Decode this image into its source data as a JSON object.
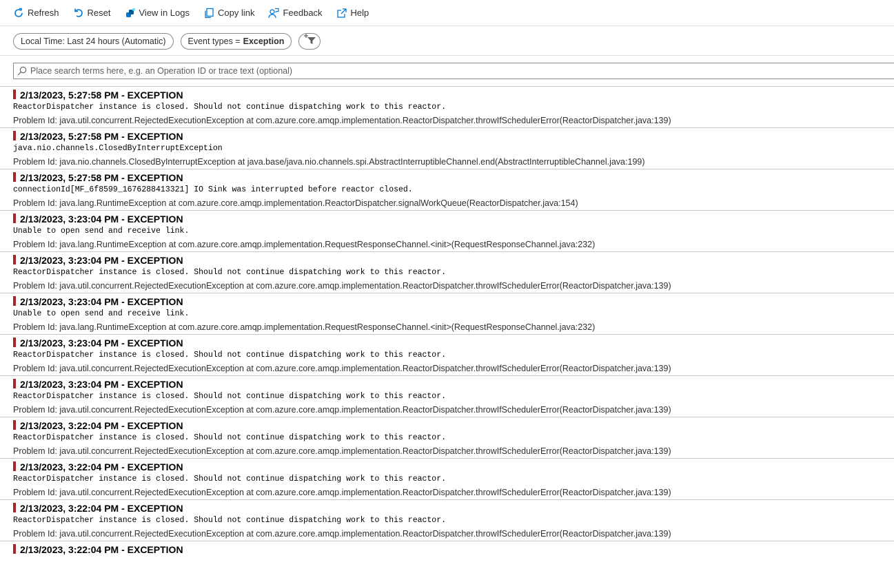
{
  "toolbar": {
    "refresh": "Refresh",
    "reset": "Reset",
    "view_in_logs": "View in Logs",
    "copy_link": "Copy link",
    "feedback": "Feedback",
    "help": "Help"
  },
  "filters": {
    "time": "Local Time: Last 24 hours (Automatic)",
    "event_types_label": "Event types =",
    "event_types_value": "Exception"
  },
  "search": {
    "placeholder": "Place search terms here, e.g. an Operation ID or trace text (optional)",
    "value": ""
  },
  "colors": {
    "accent": "#0078d4",
    "exception_marker": "#a4262c"
  },
  "entries": [
    {
      "title": "2/13/2023, 5:27:58 PM - EXCEPTION",
      "message": "ReactorDispatcher instance is closed. Should not continue dispatching work to this reactor.",
      "problem": "Problem Id: java.util.concurrent.RejectedExecutionException at com.azure.core.amqp.implementation.ReactorDispatcher.throwIfSchedulerError(ReactorDispatcher.java:139)"
    },
    {
      "title": "2/13/2023, 5:27:58 PM - EXCEPTION",
      "message": "java.nio.channels.ClosedByInterruptException",
      "problem": "Problem Id: java.nio.channels.ClosedByInterruptException at java.base/java.nio.channels.spi.AbstractInterruptibleChannel.end(AbstractInterruptibleChannel.java:199)"
    },
    {
      "title": "2/13/2023, 5:27:58 PM - EXCEPTION",
      "message": "connectionId[MF_6f8599_1676288413321] IO Sink was interrupted before reactor closed.",
      "problem": "Problem Id: java.lang.RuntimeException at com.azure.core.amqp.implementation.ReactorDispatcher.signalWorkQueue(ReactorDispatcher.java:154)"
    },
    {
      "title": "2/13/2023, 3:23:04 PM - EXCEPTION",
      "message": "Unable to open send and receive link.",
      "problem": "Problem Id: java.lang.RuntimeException at com.azure.core.amqp.implementation.RequestResponseChannel.<init>(RequestResponseChannel.java:232)"
    },
    {
      "title": "2/13/2023, 3:23:04 PM - EXCEPTION",
      "message": "ReactorDispatcher instance is closed. Should not continue dispatching work to this reactor.",
      "problem": "Problem Id: java.util.concurrent.RejectedExecutionException at com.azure.core.amqp.implementation.ReactorDispatcher.throwIfSchedulerError(ReactorDispatcher.java:139)"
    },
    {
      "title": "2/13/2023, 3:23:04 PM - EXCEPTION",
      "message": "Unable to open send and receive link.",
      "problem": "Problem Id: java.lang.RuntimeException at com.azure.core.amqp.implementation.RequestResponseChannel.<init>(RequestResponseChannel.java:232)"
    },
    {
      "title": "2/13/2023, 3:23:04 PM - EXCEPTION",
      "message": "ReactorDispatcher instance is closed. Should not continue dispatching work to this reactor.",
      "problem": "Problem Id: java.util.concurrent.RejectedExecutionException at com.azure.core.amqp.implementation.ReactorDispatcher.throwIfSchedulerError(ReactorDispatcher.java:139)"
    },
    {
      "title": "2/13/2023, 3:23:04 PM - EXCEPTION",
      "message": "ReactorDispatcher instance is closed. Should not continue dispatching work to this reactor.",
      "problem": "Problem Id: java.util.concurrent.RejectedExecutionException at com.azure.core.amqp.implementation.ReactorDispatcher.throwIfSchedulerError(ReactorDispatcher.java:139)"
    },
    {
      "title": "2/13/2023, 3:22:04 PM - EXCEPTION",
      "message": "ReactorDispatcher instance is closed. Should not continue dispatching work to this reactor.",
      "problem": "Problem Id: java.util.concurrent.RejectedExecutionException at com.azure.core.amqp.implementation.ReactorDispatcher.throwIfSchedulerError(ReactorDispatcher.java:139)"
    },
    {
      "title": "2/13/2023, 3:22:04 PM - EXCEPTION",
      "message": "ReactorDispatcher instance is closed. Should not continue dispatching work to this reactor.",
      "problem": "Problem Id: java.util.concurrent.RejectedExecutionException at com.azure.core.amqp.implementation.ReactorDispatcher.throwIfSchedulerError(ReactorDispatcher.java:139)"
    },
    {
      "title": "2/13/2023, 3:22:04 PM - EXCEPTION",
      "message": "ReactorDispatcher instance is closed. Should not continue dispatching work to this reactor.",
      "problem": "Problem Id: java.util.concurrent.RejectedExecutionException at com.azure.core.amqp.implementation.ReactorDispatcher.throwIfSchedulerError(ReactorDispatcher.java:139)"
    },
    {
      "title": "2/13/2023, 3:22:04 PM - EXCEPTION",
      "message": "",
      "problem": ""
    }
  ]
}
